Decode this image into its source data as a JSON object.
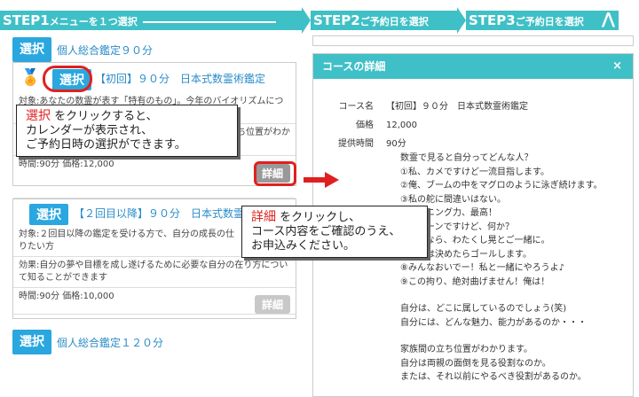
{
  "steps": {
    "step1_big": "STEP1",
    "step1_small": "メニューを１つ選択",
    "step2_big": "STEP2",
    "step2_small": "ご予約日を選択",
    "step3_big": "STEP3",
    "step3_small": "ご予約日を選択"
  },
  "group1": {
    "select": "選択",
    "title": "個人総合鑑定９０分"
  },
  "course1": {
    "select": "選択",
    "title": "【初回】９０分　日本式数霊術鑑定",
    "target": "対象:あなたの数霊が表す「特有のもの」。今年のバイオリズムについ",
    "effect": "立ち位置がわか",
    "price": "時間:90分 価格:12,000",
    "detail": "詳細"
  },
  "course2": {
    "select": "選択",
    "title": "【２回目以降】９０分　日本式数霊",
    "target1": "対象:２回目以降の鑑定を受ける方で、自分の成長の仕",
    "target2": "りたい方",
    "effect1": "効果:自分の夢や目標を成し遂げるために必要な自分の在り方につい",
    "effect2": "て知ることができます",
    "price": "時間:90分 価格:10,000",
    "detail": "詳細"
  },
  "group2": {
    "select": "選択",
    "title": "個人総合鑑定１２０分"
  },
  "callout1": {
    "hl": "選択",
    "line1": " をクリックすると、",
    "line2": "カレンダーが表示され、",
    "line3": "ご予約日時の選択ができます。"
  },
  "callout2": {
    "hl": "詳細",
    "line1": " をクリックし、",
    "line2": "コース内容をご確認のうえ、",
    "line3": "お申込みください。"
  },
  "modal": {
    "title": "コースの詳細",
    "close": "×",
    "rows": [
      {
        "k": "コース名",
        "v": "【初回】９０分　日本式数霊術鑑定"
      },
      {
        "k": "価格",
        "v": "12,000"
      },
      {
        "k": "提供時間",
        "v": "90分"
      }
    ],
    "desc": [
      "数霊で見ると自分ってどんな人？",
      "①私、カメですけど一流目指します。",
      "②俺、ブームの中をマグロのように泳ぎ続けます。",
      "③私の舵に間違いはない。",
      "④ランニング力、最高！",
      "⑤クローンですけど、何か？",
      "⑥皆となら、わたくし晃とご一緒に。",
      "⑦人生は決めたらゴールします。",
      "⑧みんなおいでー！私と一緒にやろうよ♪",
      "⑨この拘り、絶対曲げません！俺は！",
      "",
      "自分は、どこに属しているのでしょう(笑)",
      "自分には、どんな魅力、能力があるのか・・・",
      "",
      "家族間の立ち位置がわかります。",
      "自分は両親の面倒を見る役割なのか。",
      "または、それ以前にやるべき役割があるのか。"
    ]
  }
}
